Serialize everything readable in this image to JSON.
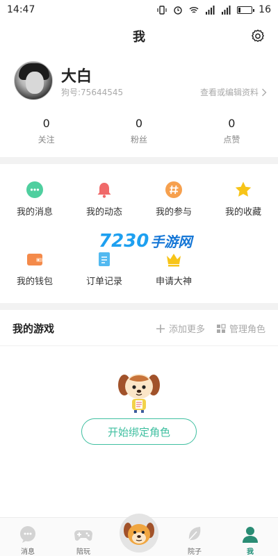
{
  "status_bar": {
    "time": "14:47",
    "battery_level": "16"
  },
  "header": {
    "title": "我"
  },
  "profile": {
    "username": "大白",
    "user_id": "狗号:75644545",
    "edit_link": "查看或编辑资料"
  },
  "stats": [
    {
      "count": "0",
      "label": "关注"
    },
    {
      "count": "0",
      "label": "粉丝"
    },
    {
      "count": "0",
      "label": "点赞"
    }
  ],
  "menu": [
    {
      "label": "我的消息",
      "icon": "message-icon",
      "color": "#4fcf9f"
    },
    {
      "label": "我的动态",
      "icon": "bell-icon",
      "color": "#f06a6a"
    },
    {
      "label": "我的参与",
      "icon": "hashtag-icon",
      "color": "#f6a04e"
    },
    {
      "label": "我的收藏",
      "icon": "star-icon",
      "color": "#f7c418"
    },
    {
      "label": "我的钱包",
      "icon": "wallet-icon",
      "color": "#f48a4a"
    },
    {
      "label": "订单记录",
      "icon": "order-icon",
      "color": "#52b9f0"
    },
    {
      "label": "申请大神",
      "icon": "crown-icon",
      "color": "#f7c418"
    }
  ],
  "watermark": {
    "number": "7230",
    "text": "手游网"
  },
  "games": {
    "title": "我的游戏",
    "add_more": "添加更多",
    "manage_roles": "管理角色",
    "bind_button": "开始绑定角色"
  },
  "tabbar": [
    {
      "label": "消息",
      "icon": "chat-bubble-icon"
    },
    {
      "label": "陪玩",
      "icon": "gamepad-icon"
    },
    {
      "label": "",
      "icon": "dog-mascot-icon"
    },
    {
      "label": "院子",
      "icon": "leaf-icon"
    },
    {
      "label": "我",
      "icon": "person-icon"
    }
  ],
  "colors": {
    "accent": "#3fbfa0",
    "active_tab": "#1e8f77"
  }
}
